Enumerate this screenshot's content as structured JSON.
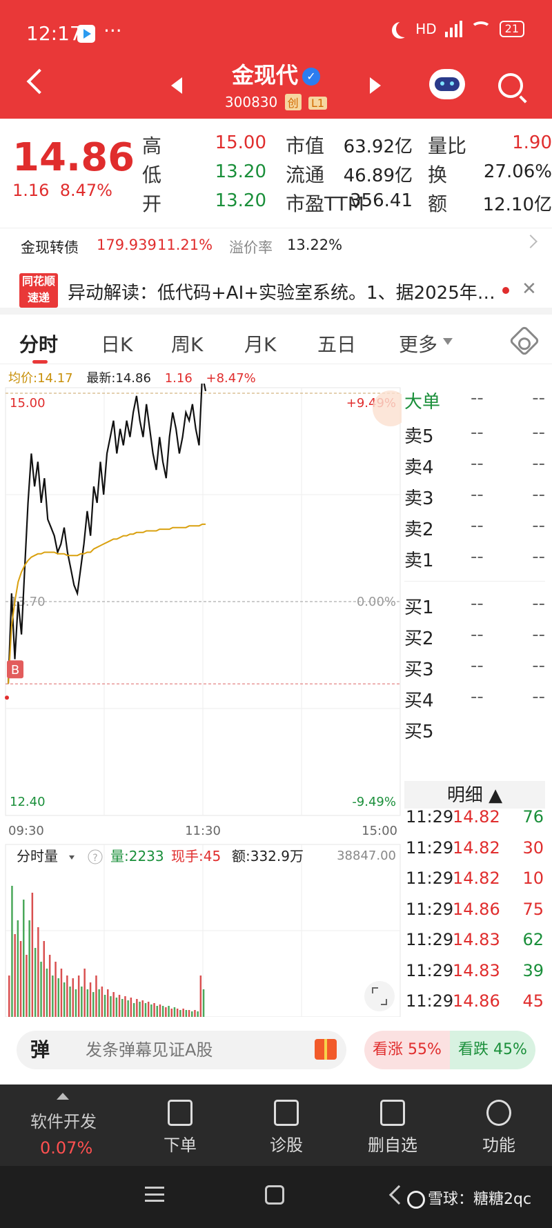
{
  "status_bar": {
    "time": "12:17",
    "dots": "···",
    "network": "HD",
    "battery": "21"
  },
  "header": {
    "name": "金现代",
    "code": "300830",
    "tag1": "创",
    "tag2": "L1"
  },
  "quote": {
    "price": "14.86",
    "change": "1.16",
    "change_pct": "8.47%",
    "fields": [
      {
        "label": "高",
        "value": "15.00",
        "color": "#e02d2d"
      },
      {
        "label": "低",
        "value": "13.20",
        "color": "#1a8f3a"
      },
      {
        "label": "开",
        "value": "13.20",
        "color": "#1a8f3a"
      },
      {
        "label": "市值",
        "value": "63.92亿",
        "color": "#222222"
      },
      {
        "label": "流通",
        "value": "46.89亿",
        "color": "#222222"
      },
      {
        "label": "市盈TTM",
        "value": "356.41",
        "color": "#222222"
      },
      {
        "label": "量比",
        "value": "1.90",
        "color": "#e02d2d"
      },
      {
        "label": "换",
        "value": "27.06%",
        "color": "#222222"
      },
      {
        "label": "额",
        "value": "12.10亿",
        "color": "#222222"
      }
    ]
  },
  "bond": {
    "name": "金现转债",
    "price": "179.939",
    "pct": "11.21%",
    "premium_label": "溢价率",
    "premium": "13.22%"
  },
  "news": {
    "logo_top": "同花顺",
    "logo_bottom": "速递",
    "text": "异动解读：低代码+AI+实验室系统。1、据2025年…",
    "close": "✕"
  },
  "tabs": [
    "分时",
    "日K",
    "周K",
    "月K",
    "五日",
    "更多"
  ],
  "chart_info": {
    "avg_label": "均价:14.17",
    "latest_label": "最新:14.86",
    "chg": "1.16",
    "pct": "+8.47%"
  },
  "chart_data": {
    "type": "line",
    "title": "",
    "y_labels_left": [
      "15.00",
      "13.70",
      "12.40"
    ],
    "y_labels_right": [
      "+9.49%",
      "0.00%",
      "-9.49%"
    ],
    "x_labels": [
      "09:30",
      "11:30",
      "15:00"
    ],
    "ylim": [
      12.4,
      15.0
    ],
    "prev_close": 13.7,
    "marker_label": "B",
    "marker_price": 13.2,
    "series": [
      {
        "name": "",
        "color": "#111111",
        "values": [
          13.2,
          13.75,
          13.35,
          13.7,
          13.5,
          13.9,
          14.3,
          14.6,
          14.4,
          14.55,
          14.3,
          14.45,
          14.2,
          14.15,
          14.1,
          14.0,
          14.05,
          14.15,
          14.0,
          13.9,
          13.8,
          13.75,
          13.9,
          14.05,
          14.25,
          14.1,
          14.4,
          14.3,
          14.55,
          14.35,
          14.6,
          14.7,
          14.8,
          14.6,
          14.75,
          14.65,
          14.8,
          14.7,
          14.85,
          14.95,
          14.8,
          14.7,
          14.9,
          14.75,
          14.6,
          14.5,
          14.7,
          14.55,
          14.45,
          14.7,
          14.85,
          14.75,
          14.6,
          14.7,
          14.85,
          14.8,
          14.9,
          14.75,
          14.65,
          15.08,
          14.98
        ]
      },
      {
        "name": "",
        "color": "#d9a00e",
        "values": [
          13.2,
          13.55,
          13.7,
          13.82,
          13.88,
          13.92,
          13.95,
          13.97,
          13.98,
          13.99,
          13.99,
          14.0,
          14.0,
          14.0,
          14.0,
          13.99,
          13.99,
          13.99,
          13.98,
          13.98,
          13.98,
          13.98,
          13.99,
          13.99,
          14.0,
          14.0,
          14.02,
          14.03,
          14.04,
          14.05,
          14.06,
          14.07,
          14.08,
          14.08,
          14.09,
          14.1,
          14.1,
          14.11,
          14.11,
          14.12,
          14.12,
          14.12,
          14.13,
          14.13,
          14.13,
          14.13,
          14.14,
          14.14,
          14.14,
          14.14,
          14.15,
          14.15,
          14.15,
          14.15,
          14.15,
          14.16,
          14.16,
          14.16,
          14.16,
          14.17,
          14.17
        ]
      }
    ]
  },
  "volume": {
    "label": "分时量",
    "help": "?",
    "vol": "量:2233",
    "hand": "现手:45",
    "amount": "额:332.9万",
    "max": "38847.00",
    "bars": [
      0.3,
      0.95,
      0.6,
      0.7,
      0.55,
      0.85,
      0.45,
      0.7,
      0.9,
      0.5,
      0.65,
      0.4,
      0.55,
      0.35,
      0.45,
      0.3,
      0.4,
      0.28,
      0.35,
      0.25,
      0.3,
      0.22,
      0.28,
      0.2,
      0.3,
      0.22,
      0.35,
      0.2,
      0.25,
      0.18,
      0.3,
      0.2,
      0.22,
      0.16,
      0.2,
      0.15,
      0.18,
      0.14,
      0.16,
      0.13,
      0.15,
      0.12,
      0.14,
      0.1,
      0.13,
      0.11,
      0.12,
      0.1,
      0.11,
      0.09,
      0.1,
      0.08,
      0.09,
      0.08,
      0.07,
      0.08,
      0.06,
      0.07,
      0.06,
      0.05,
      0.06,
      0.05,
      0.05,
      0.04,
      0.05,
      0.04,
      0.3,
      0.2
    ]
  },
  "order_book": {
    "big": {
      "label": "大单",
      "v1": "--",
      "v2": "--"
    },
    "sell": [
      {
        "label": "卖5",
        "v1": "--",
        "v2": "--"
      },
      {
        "label": "卖4",
        "v1": "--",
        "v2": "--"
      },
      {
        "label": "卖3",
        "v1": "--",
        "v2": "--"
      },
      {
        "label": "卖2",
        "v1": "--",
        "v2": "--"
      },
      {
        "label": "卖1",
        "v1": "--",
        "v2": "--"
      }
    ],
    "buy": [
      {
        "label": "买1",
        "v1": "--",
        "v2": "--"
      },
      {
        "label": "买2",
        "v1": "--",
        "v2": "--"
      },
      {
        "label": "买3",
        "v1": "--",
        "v2": "--"
      },
      {
        "label": "买4",
        "v1": "--",
        "v2": "--"
      },
      {
        "label": "买5",
        "v1": "",
        "v2": ""
      }
    ],
    "detail_title": "明细 ▲",
    "ticks": [
      {
        "time": "11:29",
        "price": "14.82",
        "qty": "76",
        "color": "#1a8f3a"
      },
      {
        "time": "11:29",
        "price": "14.82",
        "qty": "30",
        "color": "#e02d2d"
      },
      {
        "time": "11:29",
        "price": "14.82",
        "qty": "10",
        "color": "#e02d2d"
      },
      {
        "time": "11:29",
        "price": "14.86",
        "qty": "75",
        "color": "#e02d2d"
      },
      {
        "time": "11:29",
        "price": "14.83",
        "qty": "62",
        "color": "#1a8f3a"
      },
      {
        "time": "11:29",
        "price": "14.83",
        "qty": "39",
        "color": "#1a8f3a"
      },
      {
        "time": "11:29",
        "price": "14.86",
        "qty": "45",
        "color": "#e02d2d"
      }
    ]
  },
  "interaction": {
    "danmu_icon": "弹",
    "danmu_placeholder": "发条弹幕见证A股",
    "vote_up": "看涨 55%",
    "vote_down": "看跌 45%"
  },
  "bottom": {
    "sector_name": "软件开发",
    "sector_pct": "0.07%",
    "items": [
      "下单",
      "诊股",
      "删自选",
      "功能"
    ]
  },
  "watermark": "雪球：糖糖2qc"
}
